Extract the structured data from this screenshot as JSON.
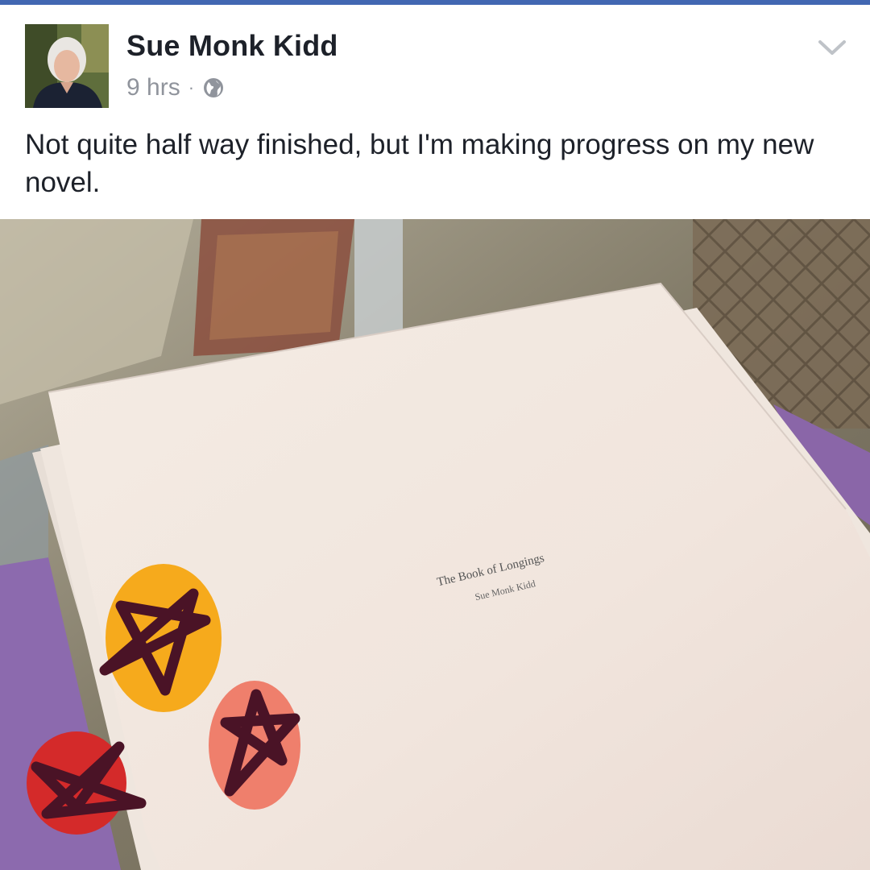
{
  "post": {
    "author": "Sue Monk Kidd",
    "time": "9 hrs",
    "separator": "·",
    "privacy_icon": "globe-icon",
    "menu_icon": "chevron-down-icon",
    "text": "Not quite half way finished, but I'm making progress on my new novel."
  },
  "photo": {
    "manuscript_title": "The Book of Longings",
    "manuscript_author": "Sue Monk Kidd",
    "stickers": [
      "star-sticker-yellow",
      "star-sticker-salmon",
      "star-sticker-red"
    ]
  },
  "colors": {
    "brand_bar": "#4267b2",
    "name": "#1d2129",
    "meta": "#90949c",
    "sticker_yellow": "#f6aa1c",
    "sticker_salmon": "#ef7f6c",
    "sticker_red": "#d42a2a",
    "sticker_stroke": "#4a1326"
  }
}
